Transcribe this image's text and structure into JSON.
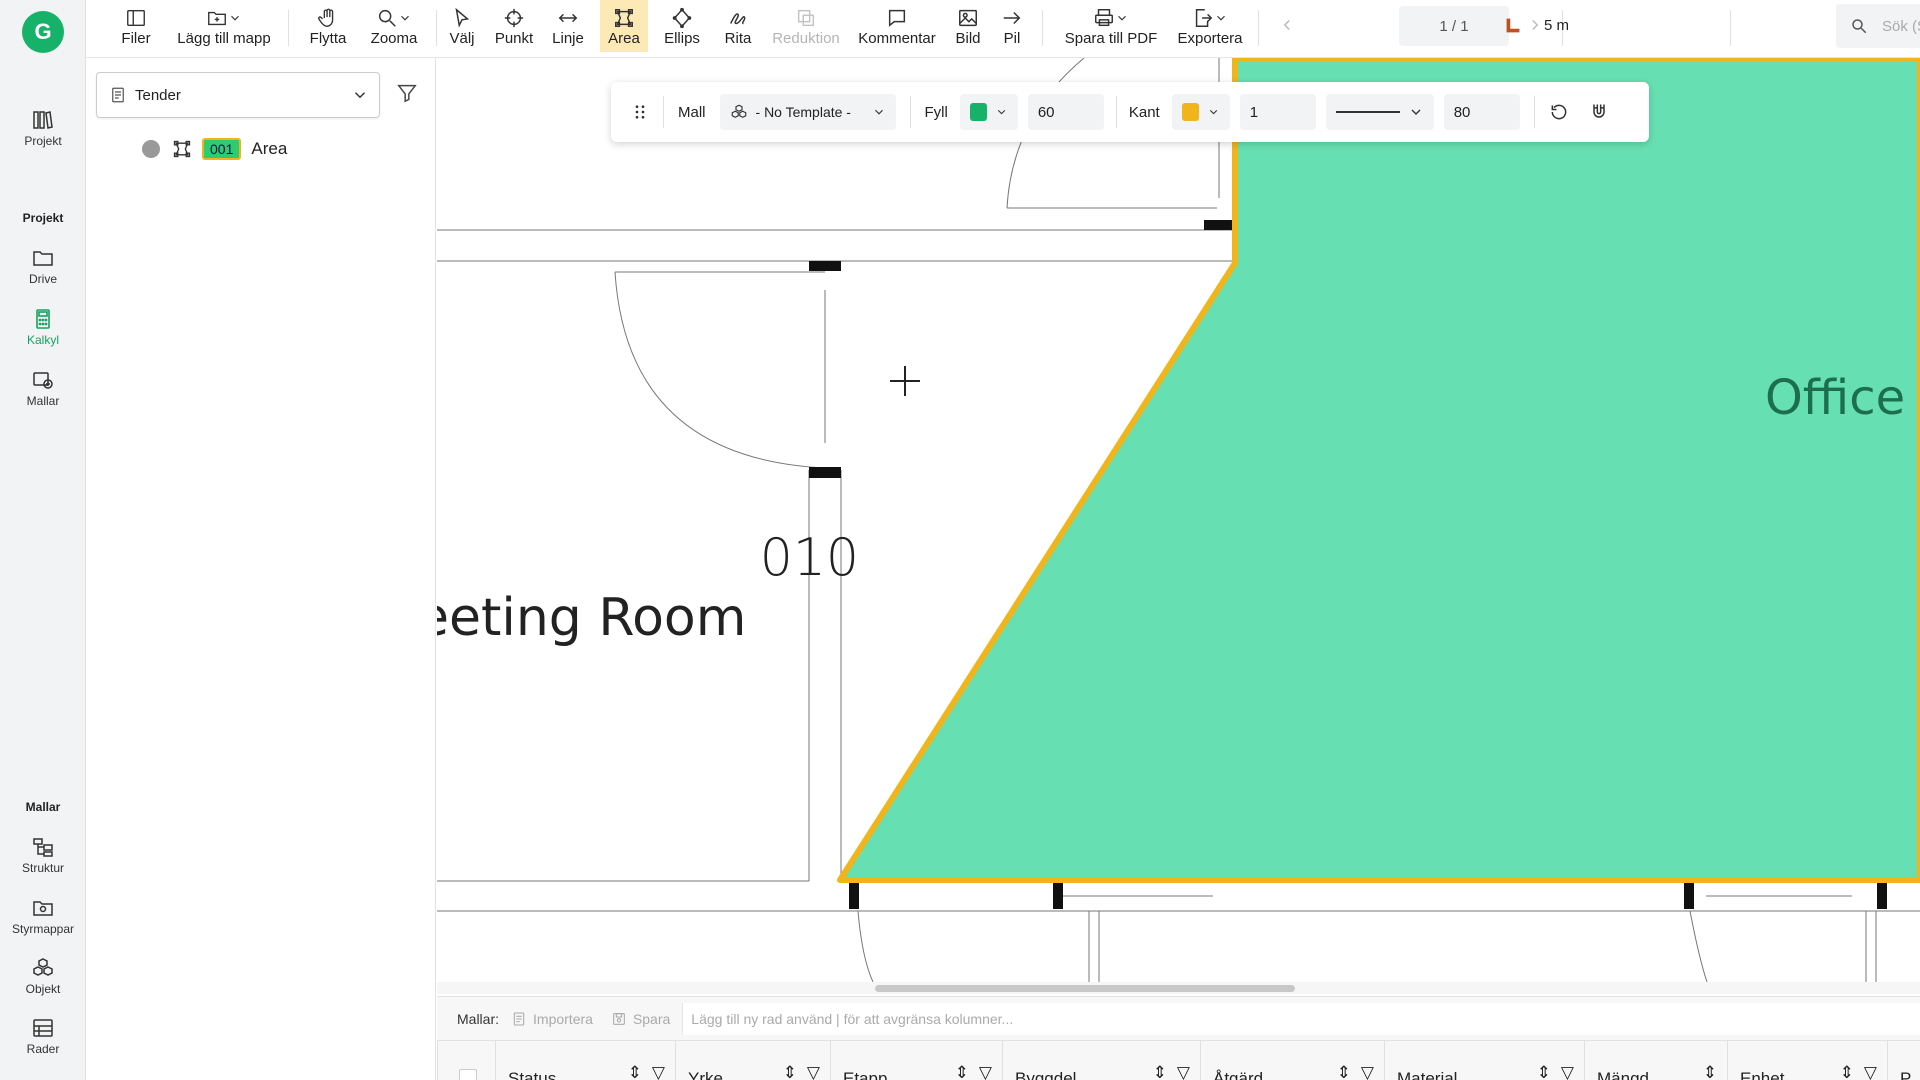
{
  "app": {
    "logo_letter": "G"
  },
  "rail": {
    "items": [
      {
        "id": "projekt",
        "label": "Projekt"
      },
      {
        "id": "drive",
        "label": "Drive"
      },
      {
        "id": "kalkyl",
        "label": "Kalkyl"
      },
      {
        "id": "mallar",
        "label": "Mallar"
      },
      {
        "id": "struktur",
        "label": "Struktur"
      },
      {
        "id": "styrmappar",
        "label": "Styrmappar"
      },
      {
        "id": "objekt",
        "label": "Objekt"
      },
      {
        "id": "rader",
        "label": "Rader"
      }
    ],
    "section_projekt": "Projekt",
    "section_mallar": "Mallar"
  },
  "toolbar": {
    "filer": "Filer",
    "lagg_till_mapp": "Lägg till mapp",
    "flytta": "Flytta",
    "zooma": "Zooma",
    "valj": "Välj",
    "punkt": "Punkt",
    "linje": "Linje",
    "area": "Area",
    "ellips": "Ellips",
    "rita": "Rita",
    "reduktion": "Reduktion",
    "kommentar": "Kommentar",
    "bild": "Bild",
    "pil": "Pil",
    "spara_pdf": "Spara till PDF",
    "exportera": "Exportera",
    "page": "1 / 1",
    "scale": "5 m",
    "search_placeholder": "Sök (Shift + Mellan"
  },
  "panel": {
    "select_value": "Tender",
    "tree": [
      {
        "badge": "001",
        "label": "Area"
      }
    ]
  },
  "props": {
    "mall_label": "Mall",
    "template_value": "- No Template -",
    "fyll_label": "Fyll",
    "fill_color": "#17b26a",
    "fill_opacity": "60",
    "kant_label": "Kant",
    "stroke_color": "#f1b51c",
    "stroke_width": "1",
    "stroke_opacity": "80"
  },
  "drawing": {
    "room_number": "010",
    "room_name": "eeting Room",
    "office_label": "Office",
    "area_fill": "#66e0b2",
    "area_stroke": "#f1b51c"
  },
  "templates_bar": {
    "label": "Mallar:",
    "importera": "Importera",
    "spara": "Spara",
    "hint": "Lägg till ny rad använd | för att avgränsa kolumner..."
  },
  "grid": {
    "columns": [
      "Status",
      "Yrke",
      "Etapp",
      "Byggdel",
      "Åtgärd",
      "Material",
      "Mängd",
      "Enhet",
      "P"
    ]
  }
}
